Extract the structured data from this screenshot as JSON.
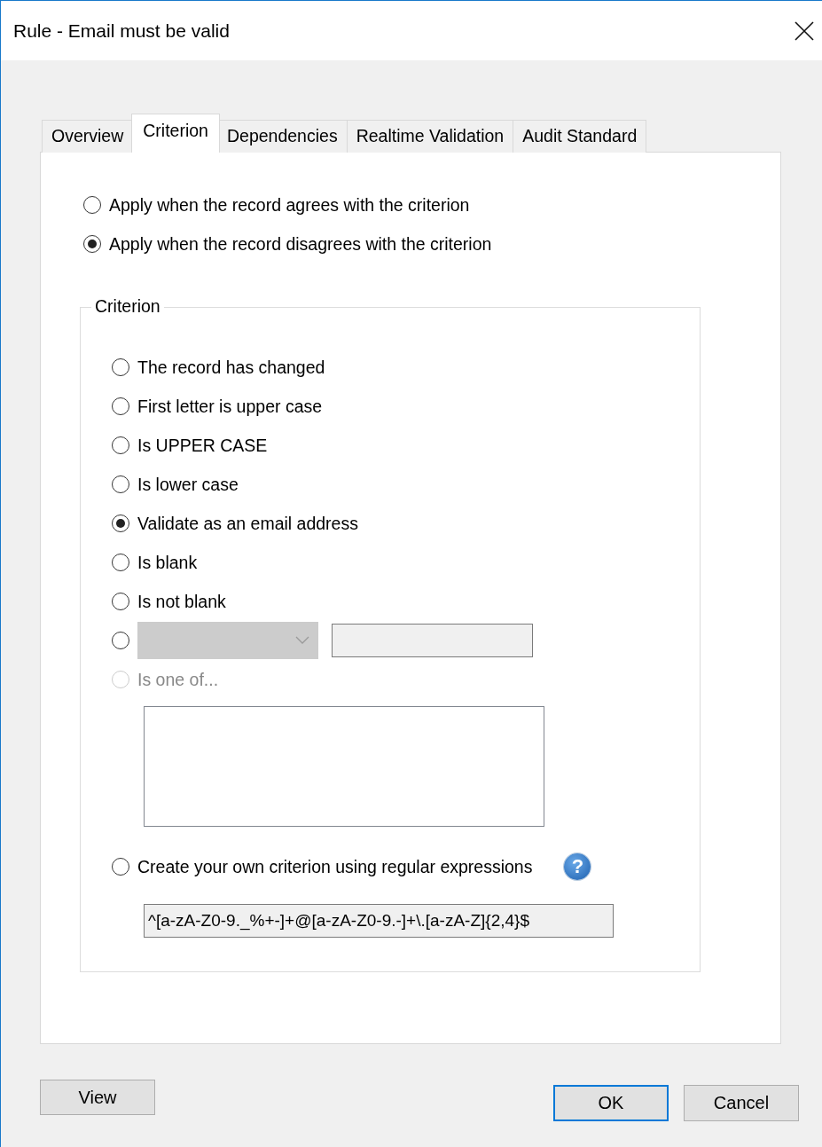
{
  "window": {
    "title": "Rule - Email must be valid"
  },
  "tabs": [
    {
      "label": "Overview",
      "selected": false
    },
    {
      "label": "Criterion",
      "selected": true
    },
    {
      "label": "Dependencies",
      "selected": false
    },
    {
      "label": "Realtime Validation",
      "selected": false
    },
    {
      "label": "Audit Standard",
      "selected": false
    }
  ],
  "apply_options": [
    {
      "label": "Apply when the record agrees with the criterion",
      "selected": false
    },
    {
      "label": "Apply when the record disagrees with the criterion",
      "selected": true
    }
  ],
  "criterion_group": {
    "title": "Criterion",
    "options": [
      {
        "kind": "radio",
        "label": "The record has changed",
        "selected": false,
        "disabled": false
      },
      {
        "kind": "radio",
        "label": "First letter is upper case",
        "selected": false,
        "disabled": false
      },
      {
        "kind": "radio",
        "label": "Is UPPER CASE",
        "selected": false,
        "disabled": false
      },
      {
        "kind": "radio",
        "label": "Is lower case",
        "selected": false,
        "disabled": false
      },
      {
        "kind": "radio",
        "label": "Validate as an email address",
        "selected": true,
        "disabled": false
      },
      {
        "kind": "radio",
        "label": "Is blank",
        "selected": false,
        "disabled": false
      },
      {
        "kind": "radio",
        "label": "Is not blank",
        "selected": false,
        "disabled": false
      },
      {
        "kind": "compare",
        "selected": false,
        "disabled": false
      },
      {
        "kind": "list",
        "label": "Is one of...",
        "selected": false,
        "disabled": true
      },
      {
        "kind": "regex",
        "label": "Create your own criterion using regular expressions",
        "selected": false,
        "disabled": false,
        "help": "?",
        "value": "^[a-zA-Z0-9._%+-]+@[a-zA-Z0-9.-]+\\.[a-zA-Z]{2,4}$"
      }
    ]
  },
  "buttons": [
    {
      "label": "View",
      "kind": "left",
      "default": false
    },
    {
      "label": "OK",
      "kind": "right",
      "default": true
    },
    {
      "label": "Cancel",
      "kind": "right",
      "default": false
    }
  ]
}
